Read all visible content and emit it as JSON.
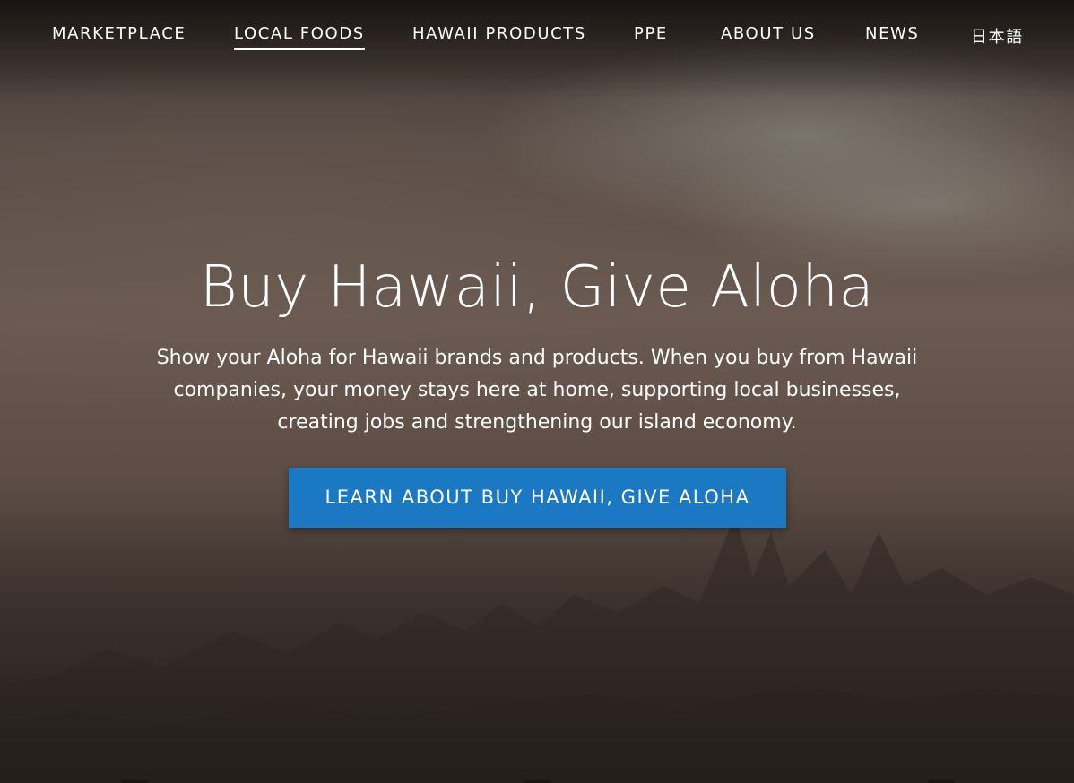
{
  "nav": {
    "items": [
      {
        "label": "MARKETPLACE"
      },
      {
        "label": "LOCAL FOODS",
        "active": true
      },
      {
        "label": "HAWAII PRODUCTS"
      },
      {
        "label": "PPE"
      },
      {
        "label": "ABOUT US"
      },
      {
        "label": "NEWS"
      },
      {
        "label": "日本語"
      }
    ]
  },
  "hero": {
    "title": "Buy Hawaii, Give Aloha",
    "description": "Show your Aloha for Hawaii brands and products. When you buy from Hawaii companies, your money stays here at home, supporting local businesses, creating jobs and strengthening our island economy.",
    "cta_label": "LEARN ABOUT BUY HAWAII, GIVE ALOHA"
  },
  "colors": {
    "cta_background": "#1b78c2",
    "text": "#ffffff"
  }
}
